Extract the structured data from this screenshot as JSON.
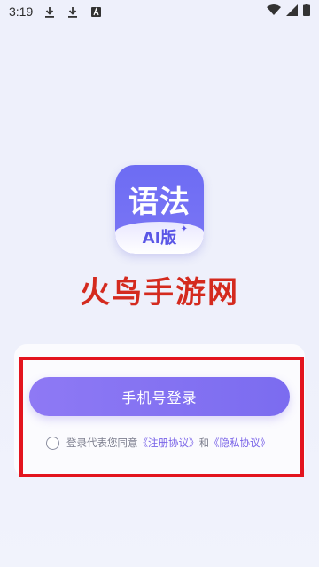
{
  "status_bar": {
    "time": "3:19",
    "icons": [
      "download-icon",
      "download-icon",
      "text-a-icon"
    ],
    "right_icons": [
      "wifi-icon",
      "signal-icon",
      "battery-icon"
    ]
  },
  "logo": {
    "main": "语法",
    "sub": "AI版",
    "accent": "#6d6cf3"
  },
  "brand_text": "火鸟手游网",
  "login": {
    "button_label": "手机号登录",
    "agreement_prefix": "登录代表您同意",
    "terms_link": "《注册协议》",
    "and_text": "和",
    "privacy_link": "《隐私协议》"
  },
  "colors": {
    "button": "#8e79f4",
    "link": "#7a64e8",
    "highlight": "#e3141e"
  }
}
